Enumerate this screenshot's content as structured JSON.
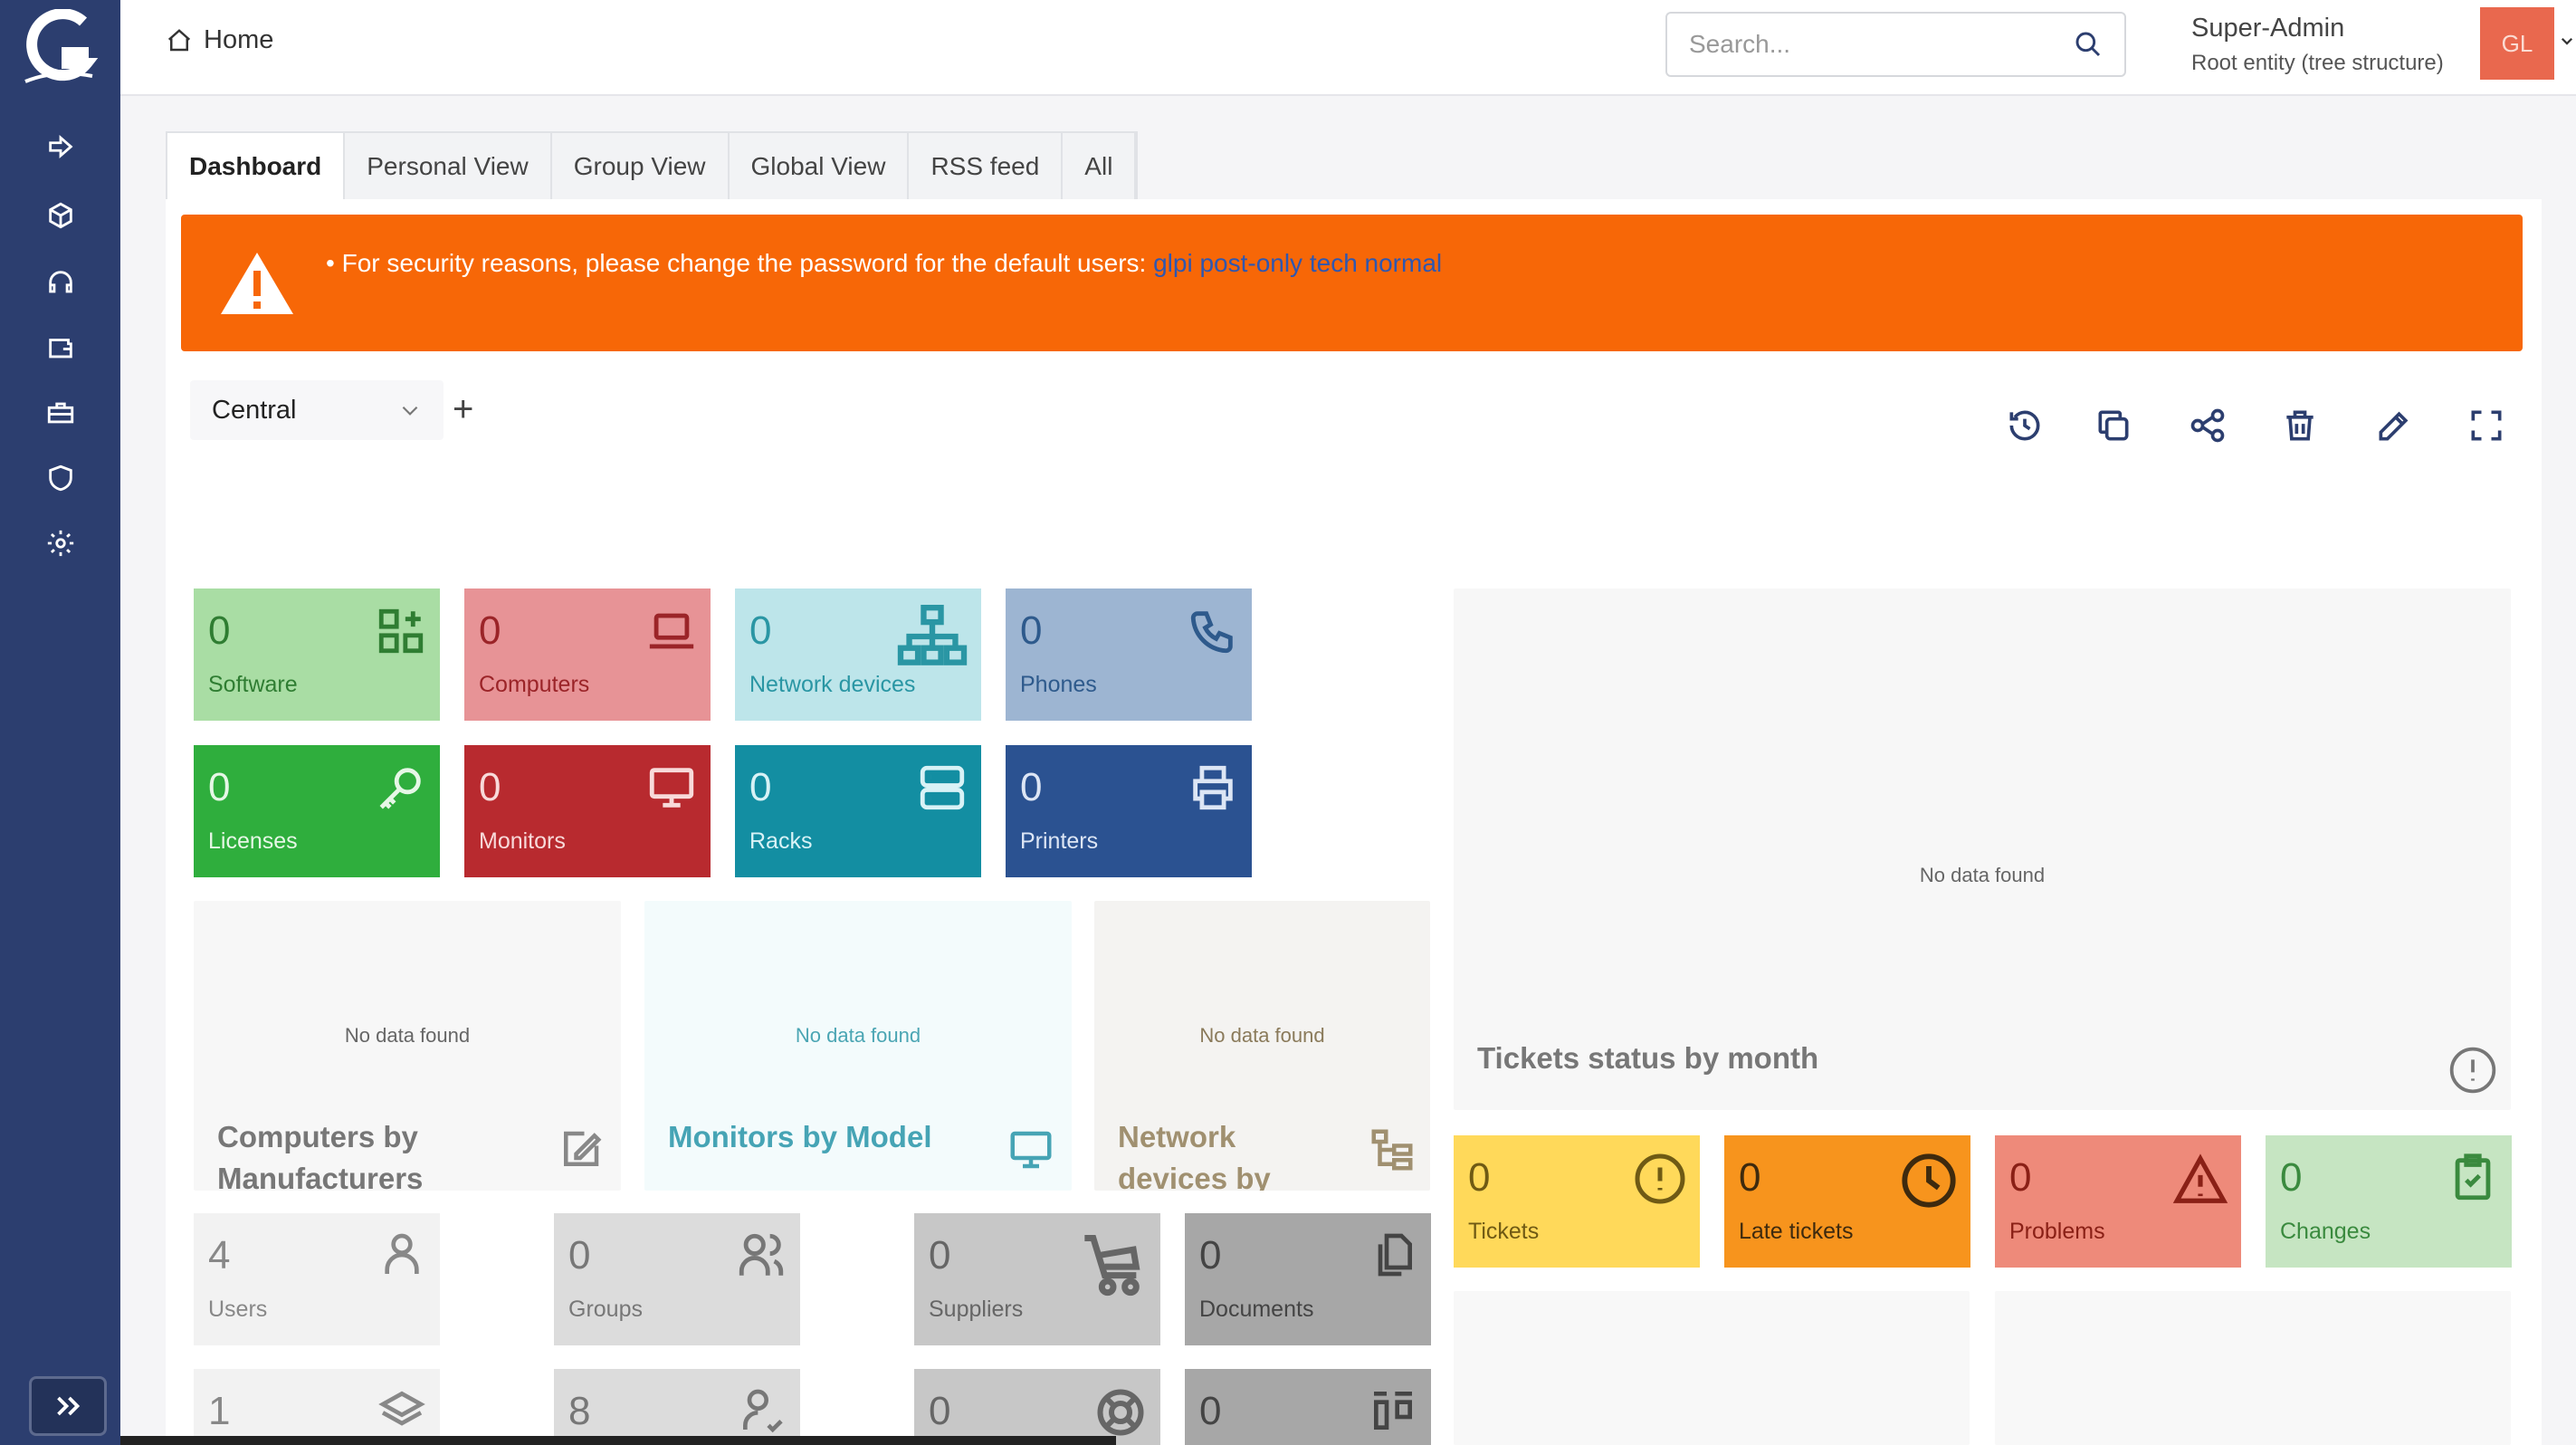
{
  "colors": {
    "sidebar": "#2c3e6f",
    "accent_orange": "#f76707",
    "avatar": "#e9684e"
  },
  "sidebar": {
    "items": [
      {
        "icon": "sign-in-icon"
      },
      {
        "icon": "box-icon"
      },
      {
        "icon": "headset-icon"
      },
      {
        "icon": "wallet-icon"
      },
      {
        "icon": "briefcase-icon"
      },
      {
        "icon": "shield-icon"
      },
      {
        "icon": "gear-icon"
      }
    ],
    "collapse_icon": "double-chevron-right-icon"
  },
  "header": {
    "breadcrumb": "Home",
    "search_placeholder": "Search...",
    "user_name": "Super-Admin",
    "entity": "Root entity (tree structure)",
    "avatar_initials": "GL"
  },
  "tabs": [
    "Dashboard",
    "Personal View",
    "Group View",
    "Global View",
    "RSS feed",
    "All"
  ],
  "alert": {
    "text": "For security reasons, please change the password for the default users:",
    "users": "glpi post-only tech normal"
  },
  "dashboard": {
    "selected": "Central"
  },
  "cards_row1": [
    {
      "value": "0",
      "label": "Software",
      "bg": "#a9dda4",
      "fg": "#2f7d32",
      "icon": "apps-plus-icon"
    },
    {
      "value": "0",
      "label": "Computers",
      "bg": "#e79396",
      "fg": "#9b2428",
      "icon": "laptop-icon"
    },
    {
      "value": "0",
      "label": "Network devices",
      "bg": "#bde5ea",
      "fg": "#2a96a4",
      "icon": "network-icon"
    },
    {
      "value": "0",
      "label": "Phones",
      "bg": "#9db5d2",
      "fg": "#2e5a8c",
      "icon": "phone-icon"
    }
  ],
  "cards_row2": [
    {
      "value": "0",
      "label": "Licenses",
      "bg": "#2fae3d",
      "fg": "#e6f7e6",
      "icon": "key-icon"
    },
    {
      "value": "0",
      "label": "Monitors",
      "bg": "#b82a2f",
      "fg": "#f8dada",
      "icon": "monitor-icon"
    },
    {
      "value": "0",
      "label": "Racks",
      "bg": "#138ea2",
      "fg": "#d8f2f6",
      "icon": "server-icon"
    },
    {
      "value": "0",
      "label": "Printers",
      "bg": "#2b5291",
      "fg": "#dde6f5",
      "icon": "printer-icon"
    }
  ],
  "big_cards": [
    {
      "title": "Computers by Manufacturers",
      "empty": "No data found",
      "icon": "edit-icon"
    },
    {
      "title": "Monitors by Model",
      "empty": "No data found",
      "icon": "monitor-icon"
    },
    {
      "title": "Network devices by",
      "empty": "No data found",
      "icon": "tree-icon"
    },
    {
      "title": "Tickets status by month",
      "empty": "No data found",
      "icon": "alert-circle-icon"
    }
  ],
  "cards_row3": [
    {
      "value": "4",
      "label": "Users",
      "bg": "#f2f2f2",
      "fg": "#888",
      "icon": "user-icon"
    },
    {
      "value": "0",
      "label": "Groups",
      "bg": "#dcdcdc",
      "fg": "#777",
      "icon": "users-icon"
    },
    {
      "value": "0",
      "label": "Suppliers",
      "bg": "#c7c7c7",
      "fg": "#666",
      "icon": "cart-icon"
    },
    {
      "value": "0",
      "label": "Documents",
      "bg": "#a7a7a7",
      "fg": "#444",
      "icon": "files-icon"
    }
  ],
  "cards_row4": [
    {
      "value": "1",
      "bg": "#f2f2f2",
      "fg": "#888",
      "icon": "stack-icon"
    },
    {
      "value": "8",
      "bg": "#dcdcdc",
      "fg": "#777",
      "icon": "user-check-icon"
    },
    {
      "value": "0",
      "bg": "#c7c7c7",
      "fg": "#666",
      "icon": "lifebuoy-icon"
    },
    {
      "value": "0",
      "bg": "#a7a7a7",
      "fg": "#444",
      "icon": "layout-icon"
    }
  ],
  "ticket_cards": [
    {
      "value": "0",
      "label": "Tickets",
      "bg": "#ffd95a",
      "fg": "#6f5a14",
      "icon": "exclamation-circle-icon"
    },
    {
      "value": "0",
      "label": "Late tickets",
      "bg": "#f7941d",
      "fg": "#3e2a0e",
      "icon": "clock-icon"
    },
    {
      "value": "0",
      "label": "Problems",
      "bg": "#ee8a7a",
      "fg": "#8a2016",
      "icon": "warning-icon"
    },
    {
      "value": "0",
      "label": "Changes",
      "bg": "#c6e5c2",
      "fg": "#3a8a3e",
      "icon": "clipboard-check-icon"
    }
  ]
}
